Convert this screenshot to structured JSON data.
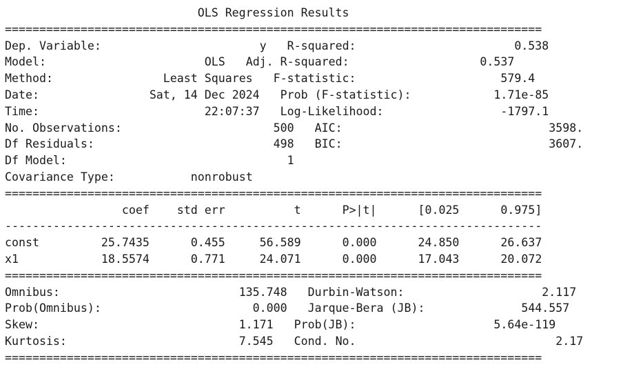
{
  "title": "OLS Regression Results",
  "separator": "==============================================================================",
  "dash_separator": "------------------------------------------------------------------------------",
  "model_summary": {
    "left": [
      {
        "label": "Dep. Variable:",
        "value": "y"
      },
      {
        "label": "Model:",
        "value": "OLS"
      },
      {
        "label": "Method:",
        "value": "Least Squares"
      },
      {
        "label": "Date:",
        "value": "Sat, 14 Dec 2024"
      },
      {
        "label": "Time:",
        "value": "22:07:37"
      },
      {
        "label": "No. Observations:",
        "value": "500"
      },
      {
        "label": "Df Residuals:",
        "value": "498"
      },
      {
        "label": "Df Model:",
        "value": "1"
      },
      {
        "label": "Covariance Type:",
        "value": "nonrobust"
      }
    ],
    "right": [
      {
        "label": "R-squared:",
        "value": "0.538"
      },
      {
        "label": "Adj. R-squared:",
        "value": "0.537"
      },
      {
        "label": "F-statistic:",
        "value": "579.4"
      },
      {
        "label": "Prob (F-statistic):",
        "value": "1.71e-85"
      },
      {
        "label": "Log-Likelihood:",
        "value": "-1797.1"
      },
      {
        "label": "AIC:",
        "value": "3598."
      },
      {
        "label": "BIC:",
        "value": "3607."
      }
    ]
  },
  "coefficients": {
    "headers": [
      "coef",
      "std err",
      "t",
      "P>|t|",
      "[0.025",
      "0.975]"
    ],
    "rows": [
      {
        "name": "const",
        "values": [
          "25.7435",
          "0.455",
          "56.589",
          "0.000",
          "24.850",
          "26.637"
        ]
      },
      {
        "name": "x1",
        "values": [
          "18.5574",
          "0.771",
          "24.071",
          "0.000",
          "17.043",
          "20.072"
        ]
      }
    ]
  },
  "diagnostics": {
    "left": [
      {
        "label": "Omnibus:",
        "value": "135.748"
      },
      {
        "label": "Prob(Omnibus):",
        "value": "0.000"
      },
      {
        "label": "Skew:",
        "value": "1.171"
      },
      {
        "label": "Kurtosis:",
        "value": "7.545"
      }
    ],
    "right": [
      {
        "label": "Durbin-Watson:",
        "value": "2.117"
      },
      {
        "label": "Jarque-Bera (JB):",
        "value": "544.557"
      },
      {
        "label": "Prob(JB):",
        "value": "5.64e-119"
      },
      {
        "label": "Cond. No.",
        "value": "2.17"
      }
    ]
  }
}
